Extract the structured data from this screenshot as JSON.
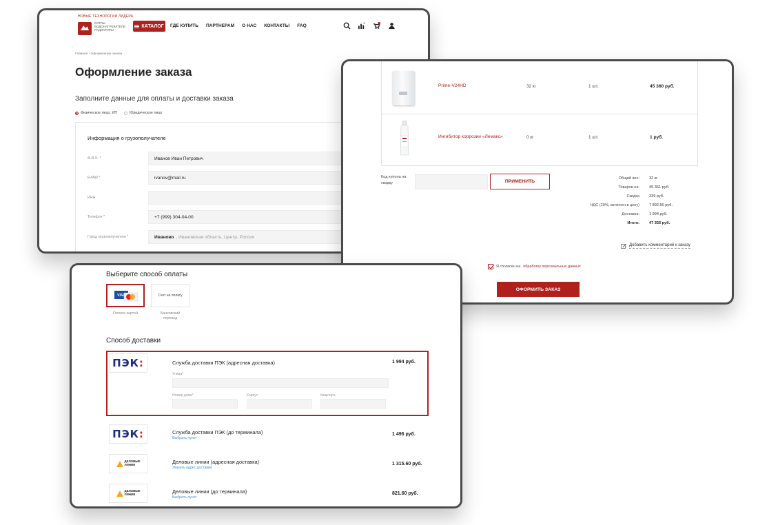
{
  "header": {
    "brand_tagline": "НОВЫЕ ТЕХНОЛОГИИ ЛИДЕРА",
    "logo_subtitle": "КОТЛЫ ВОДОНАГРЕВАТЕЛИ РАДИАТОРЫ",
    "catalog_label": "КАТАЛОГ",
    "nav": [
      "ГДЕ КУПИТЬ",
      "ПАРТНЕРАМ",
      "О НАС",
      "КОНТАКТЫ",
      "FAQ"
    ],
    "cart_count": "1",
    "icons": [
      "search-icon",
      "compare-icon",
      "cart-icon",
      "user-icon"
    ],
    "accent_color": "#b0201c"
  },
  "checkout": {
    "breadcrumb": "Главная › Оформление заказа",
    "title": "Оформление заказа",
    "subtitle": "Заполните данные для оплаты и доставки заказа",
    "person_types": {
      "individual": "Физическое лицо, ИП",
      "legal": "Юридическое лицо"
    },
    "recipient": {
      "title": "Информация о грузополучателе",
      "fields": [
        {
          "label": "Ф.И.О. *",
          "value": "Иванов Иван Петрович"
        },
        {
          "label": "E-Mail *",
          "value": "ivanov@mail.ru"
        },
        {
          "label": "ИНН",
          "value": ""
        },
        {
          "label": "Телефон *",
          "value": "+7 (999) 304-04-00"
        },
        {
          "label": "Город грузополучателя *",
          "value": "Иваново",
          "hint": ", Ивановская область, Центр, Россия"
        }
      ]
    }
  },
  "cart": {
    "items": [
      {
        "name": "Prime-V24HD",
        "weight": "32 кг",
        "qty": "1 шт.",
        "price": "45 360 руб."
      },
      {
        "name": "Ингибитор коррозии «Лемакс»",
        "weight": "0 кг",
        "qty": "1 шт.",
        "price": "1 руб."
      }
    ],
    "coupon_label": "Код купона на скидку",
    "coupon_value": "",
    "apply_label": "ПРИМЕНИТЬ",
    "summary": [
      {
        "label": "Общий вес:",
        "value": "32 кг"
      },
      {
        "label": "Товаров на:",
        "value": "45 361 руб."
      },
      {
        "label": "Скидка",
        "value": "339 руб."
      },
      {
        "label": "НДС (20%, включен в цену)",
        "value": "7 892.50 руб."
      },
      {
        "label": "Доставка:",
        "value": "1 994 руб."
      },
      {
        "label": "Итого:",
        "value": "47 355 руб."
      }
    ],
    "comment_link": "Добавить комментарий к заказу",
    "agree_text": "Я согласен на",
    "agree_link": "обработку персональных данных",
    "submit_label": "ОФОРМИТЬ ЗАКАЗ"
  },
  "payment": {
    "title": "Выберите способ оплаты",
    "methods": [
      {
        "label": "Оплата картой",
        "selected": true
      },
      {
        "label": "Банковский перевод",
        "card_text": "Счет на оплату",
        "selected": false
      }
    ]
  },
  "delivery": {
    "title": "Способ доставки",
    "options": [
      {
        "name": "Служба доставки ПЭК (адресная доставка)",
        "price": "1 994 руб.",
        "logo": "ПЭК",
        "selected": true,
        "fields": {
          "street": "Улица*",
          "house": "Номер дома*",
          "building": "Корпус",
          "apartment": "Квартира"
        }
      },
      {
        "name": "Служба доставки ПЭК (до терминала)",
        "link": "Выбрать пункт",
        "price": "1 496 руб.",
        "logo": "ПЭК"
      },
      {
        "name": "Деловые линии (адресная доставка)",
        "link": "Указать адрес доставки",
        "price": "1 315.60 руб.",
        "logo": "ДЕЛОВЫЕ ЛИНИИ"
      },
      {
        "name": "Деловые линии (до терминала)",
        "link": "Выбрать пункт",
        "price": "821.60 руб.",
        "logo": "ДЕЛОВЫЕ ЛИНИИ"
      }
    ]
  }
}
